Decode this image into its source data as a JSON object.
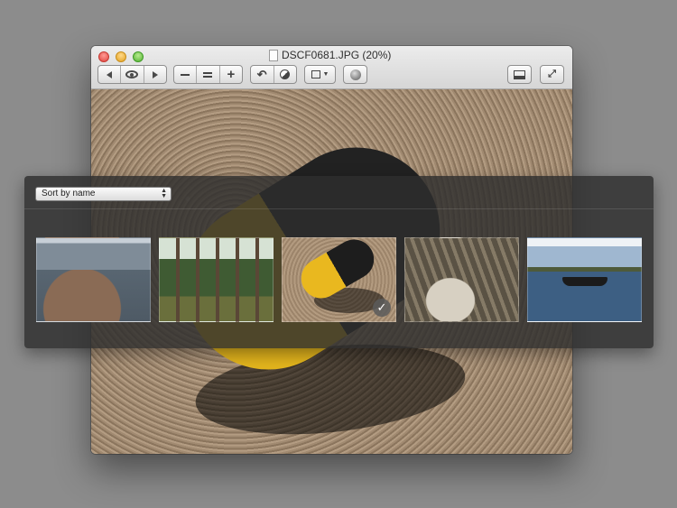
{
  "window": {
    "title": "DSCF0681.JPG (20%)"
  },
  "toolbar": {
    "previous_icon": "triangle-left",
    "slideshow_icon": "eye",
    "next_icon": "triangle-right",
    "zoom_out_icon": "minus",
    "actual_size_icon": "equals",
    "zoom_in_icon": "plus",
    "rotate_icon": "rotate-left",
    "adjust_icon": "half-circle",
    "crop_icon": "crop-rectangle",
    "share_icon": "globe",
    "sidebar_icon": "sidebar",
    "fullscreen_icon": "arrows-expand"
  },
  "browser": {
    "sort_label": "Sort by name",
    "thumbnails": [
      {
        "subject": "rocky shoreline"
      },
      {
        "subject": "forest trees"
      },
      {
        "subject": "yellow black buoy",
        "selected": true,
        "badge": "✓"
      },
      {
        "subject": "tree roots"
      },
      {
        "subject": "motorboat on lake"
      }
    ]
  }
}
